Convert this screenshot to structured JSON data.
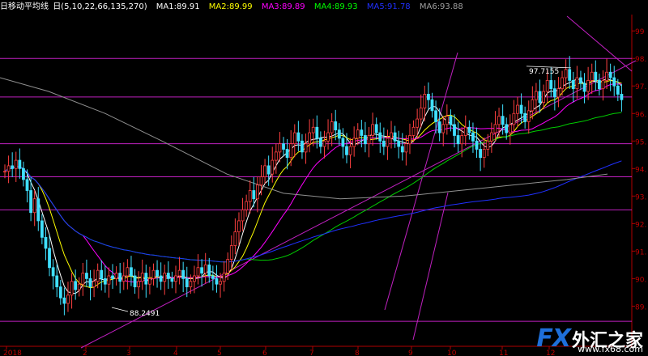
{
  "header": {
    "title": "日移动平均线",
    "params": "日(5,10,22,66,135,270)",
    "ma": [
      {
        "label": "MA1:89.91",
        "color": "#ffffff"
      },
      {
        "label": "MA2:89.99",
        "color": "#ffff00"
      },
      {
        "label": "MA3:89.89",
        "color": "#ff00ff"
      },
      {
        "label": "MA4:89.93",
        "color": "#00ff00"
      },
      {
        "label": "MA5:91.78",
        "color": "#2030ff"
      },
      {
        "label": "MA6:93.88",
        "color": "#a0a0a0"
      }
    ]
  },
  "watermark": {
    "brand": "FX",
    "chinese": "外汇之家",
    "url": "www.fx68.com"
  },
  "chart_data": {
    "type": "candlestick",
    "ylim": [
      88.6,
      99.3
    ],
    "y_ticks": [
      {
        "v": 99,
        "label": "99"
      },
      {
        "v": 98,
        "label": "98."
      },
      {
        "v": 97,
        "label": "97."
      },
      {
        "v": 96,
        "label": "96."
      },
      {
        "v": 95,
        "label": "95."
      },
      {
        "v": 94,
        "label": "94."
      },
      {
        "v": 93,
        "label": "93."
      },
      {
        "v": 92,
        "label": "92."
      },
      {
        "v": 91,
        "label": "91."
      },
      {
        "v": 90,
        "label": "90."
      },
      {
        "v": 89,
        "label": "89."
      }
    ],
    "x_ticks": [
      "2018",
      "2",
      "3",
      "4",
      "5",
      "6",
      "7",
      "8",
      "9",
      "10",
      "11",
      "12"
    ],
    "annotations": [
      {
        "text": "97.7155",
        "value": 97.7155
      },
      {
        "text": "88.2491",
        "value": 88.2491
      }
    ],
    "horizontal_levels": [
      98.0,
      96.6,
      94.9,
      93.7,
      92.5,
      88.45
    ],
    "ohlc_close": [
      93.9,
      94.1,
      94.0,
      94.3,
      94.0,
      93.6,
      93.2,
      92.4,
      92.9,
      92.1,
      91.5,
      91.1,
      90.4,
      90.1,
      89.7,
      89.3,
      89.1,
      89.4,
      89.9,
      89.6,
      89.8,
      90.2,
      90.0,
      89.7,
      89.9,
      90.3,
      90.0,
      89.8,
      90.1,
      90.0,
      90.2,
      89.9,
      90.1,
      90.4,
      90.1,
      89.7,
      89.9,
      90.2,
      89.8,
      90.0,
      90.3,
      90.1,
      89.9,
      90.2,
      90.0,
      89.9,
      90.1,
      90.3,
      90.0,
      89.7,
      89.9,
      90.1,
      90.4,
      90.2,
      90.5,
      90.1,
      90.0,
      89.8,
      89.9,
      90.2,
      90.7,
      91.2,
      91.7,
      92.1,
      92.5,
      92.8,
      93.2,
      92.9,
      93.4,
      93.7,
      94.1,
      93.8,
      94.3,
      94.6,
      94.9,
      94.7,
      94.4,
      94.9,
      95.3,
      95.0,
      94.6,
      94.9,
      95.3,
      95.5,
      95.1,
      94.8,
      95.0,
      95.3,
      95.7,
      95.4,
      95.1,
      94.8,
      94.5,
      94.8,
      95.1,
      95.4,
      95.2,
      94.9,
      95.2,
      95.6,
      95.3,
      95.0,
      94.8,
      95.1,
      95.3,
      95.0,
      94.8,
      94.6,
      94.9,
      95.2,
      95.5,
      95.8,
      96.2,
      96.7,
      96.5,
      96.1,
      95.7,
      95.3,
      95.6,
      95.9,
      95.6,
      95.2,
      94.9,
      95.2,
      95.5,
      95.3,
      95.0,
      94.7,
      94.4,
      94.7,
      95.0,
      95.3,
      95.6,
      95.9,
      95.6,
      95.3,
      95.6,
      96.0,
      96.3,
      96.0,
      95.7,
      96.1,
      96.5,
      96.8,
      96.4,
      96.8,
      97.2,
      96.9,
      96.6,
      96.9,
      97.3,
      97.6,
      97.2,
      96.9,
      97.3,
      97.1,
      96.8,
      97.2,
      97.5,
      97.2,
      96.9,
      97.2,
      97.5,
      97.3,
      97.0,
      96.7,
      96.5
    ]
  }
}
